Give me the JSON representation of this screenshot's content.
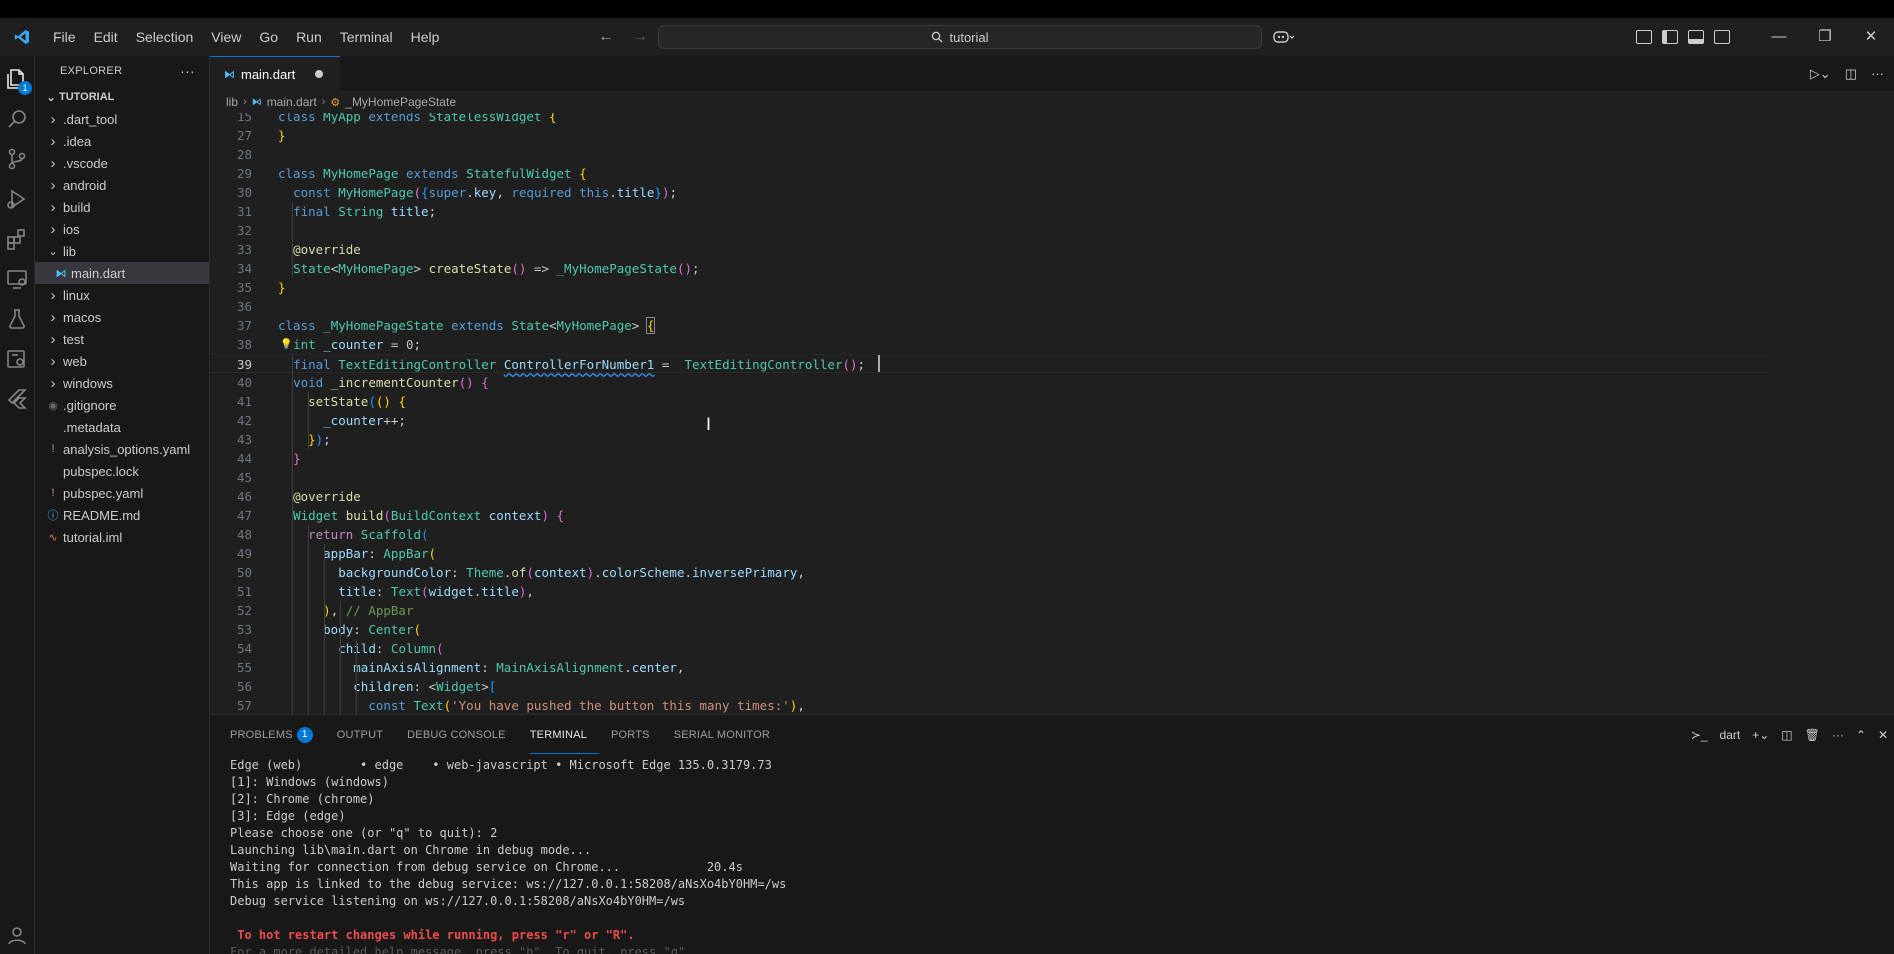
{
  "titlebar": {
    "menu": [
      "File",
      "Edit",
      "Selection",
      "View",
      "Go",
      "Run",
      "Terminal",
      "Help"
    ],
    "search_text": "tutorial",
    "back_label": "←",
    "forward_label": "→"
  },
  "explorer": {
    "header": "EXPLORER",
    "more_label": "···",
    "section": "TUTORIAL",
    "items": [
      {
        "label": ".dart_tool",
        "type": "folder",
        "open": false
      },
      {
        "label": ".idea",
        "type": "folder",
        "open": false
      },
      {
        "label": ".vscode",
        "type": "folder",
        "open": false
      },
      {
        "label": "android",
        "type": "folder",
        "open": false
      },
      {
        "label": "build",
        "type": "folder",
        "open": false
      },
      {
        "label": "ios",
        "type": "folder",
        "open": false
      },
      {
        "label": "lib",
        "type": "folder",
        "open": true
      },
      {
        "label": "main.dart",
        "type": "dart",
        "child": true,
        "selected": true
      },
      {
        "label": "linux",
        "type": "folder",
        "open": false
      },
      {
        "label": "macos",
        "type": "folder",
        "open": false
      },
      {
        "label": "test",
        "type": "folder",
        "open": false
      },
      {
        "label": "web",
        "type": "folder",
        "open": false
      },
      {
        "label": "windows",
        "type": "folder",
        "open": false
      },
      {
        "label": ".gitignore",
        "type": "gitignore"
      },
      {
        "label": ".metadata",
        "type": "file"
      },
      {
        "label": "analysis_options.yaml",
        "type": "yaml"
      },
      {
        "label": "pubspec.lock",
        "type": "file"
      },
      {
        "label": "pubspec.yaml",
        "type": "yaml"
      },
      {
        "label": "README.md",
        "type": "info"
      },
      {
        "label": "tutorial.iml",
        "type": "rss"
      }
    ]
  },
  "editor": {
    "tab_label": "main.dart",
    "breadcrumb": [
      "lib",
      "main.dart",
      "_MyHomePageState"
    ],
    "lines": [
      {
        "n": "15",
        "html": "<span class=\"kw\">class</span> <span class=\"ty\">MyApp</span> <span class=\"kw\">extends</span> <span class=\"ty\">StatelessWidget</span> <span class=\"br1\">{</span>"
      },
      {
        "n": "27",
        "html": "<span class=\"br1\">}</span>"
      },
      {
        "n": "28",
        "html": ""
      },
      {
        "n": "29",
        "html": "<span class=\"kw\">class</span> <span class=\"ty\">MyHomePage</span> <span class=\"kw\">extends</span> <span class=\"ty\">StatefulWidget</span> <span class=\"br1\">{</span>"
      },
      {
        "n": "30",
        "html": "  <span class=\"kw\">const</span> <span class=\"ty\">MyHomePage</span><span class=\"br2\">(</span><span class=\"br3\">{</span><span class=\"kw\">super</span>.<span class=\"vr\">key</span>, <span class=\"kw\">required</span> <span class=\"kw\">this</span>.<span class=\"vr\">title</span><span class=\"br3\">}</span><span class=\"br2\">)</span>;"
      },
      {
        "n": "31",
        "html": "  <span class=\"kw\">final</span> <span class=\"ty\">String</span> <span class=\"vr\">title</span>;"
      },
      {
        "n": "32",
        "html": ""
      },
      {
        "n": "33",
        "html": "  <span class=\"dc\">@override</span>"
      },
      {
        "n": "34",
        "html": "  <span class=\"ty\">State</span>&lt;<span class=\"ty\">MyHomePage</span>&gt; <span class=\"fn\">createState</span><span class=\"br2\">()</span> =&gt; <span class=\"ty\">_MyHomePageState</span><span class=\"br2\">()</span>;"
      },
      {
        "n": "35",
        "html": "<span class=\"br1\">}</span>"
      },
      {
        "n": "36",
        "html": ""
      },
      {
        "n": "37",
        "html": "<span class=\"kw\">class</span> <span class=\"ty\">_MyHomePageState</span> <span class=\"kw\">extends</span> <span class=\"ty\">State</span>&lt;<span class=\"ty\">MyHomePage</span>&gt; <span class=\"br1\" style=\"outline:1px solid #888\">{</span>"
      },
      {
        "n": "38",
        "html": "  <span class=\"ty\">int</span> <span class=\"vr\">_counter</span> = <span class=\"nu\">0</span>;",
        "bulb": true
      },
      {
        "n": "39",
        "html": "  <span class=\"kw\">final</span> <span class=\"ty\">TextEditingController</span> <span class=\"vr ul\">ControllerForNumber1</span> =  <span class=\"ty\">TextEditingController</span><span class=\"br2\">()</span>;",
        "current": true
      },
      {
        "n": "40",
        "html": "  <span class=\"kw\">void</span> <span class=\"fn\">_incrementCounter</span><span class=\"br2\">()</span> <span class=\"br2\">{</span>"
      },
      {
        "n": "41",
        "html": "    <span class=\"fn\">setState</span><span class=\"br3\">(</span><span class=\"br1\">()</span> <span class=\"br1\">{</span>"
      },
      {
        "n": "42",
        "html": "      <span class=\"vr\">_counter</span>++;"
      },
      {
        "n": "43",
        "html": "    <span class=\"br1\">}</span><span class=\"br3\">)</span>;"
      },
      {
        "n": "44",
        "html": "  <span class=\"br2\">}</span>"
      },
      {
        "n": "45",
        "html": ""
      },
      {
        "n": "46",
        "html": "  <span class=\"dc\">@override</span>"
      },
      {
        "n": "47",
        "html": "  <span class=\"ty\">Widget</span> <span class=\"fn\">build</span><span class=\"br2\">(</span><span class=\"ty\">BuildContext</span> <span class=\"vr\">context</span><span class=\"br2\">)</span> <span class=\"br2\">{</span>"
      },
      {
        "n": "48",
        "html": "    <span class=\"kw2\">return</span> <span class=\"ty\">Scaffold</span><span class=\"br3\">(</span>"
      },
      {
        "n": "49",
        "html": "      <span class=\"vr\">appBar</span>: <span class=\"ty\">AppBar</span><span class=\"br1\">(</span>"
      },
      {
        "n": "50",
        "html": "        <span class=\"vr\">backgroundColor</span>: <span class=\"ty\">Theme</span>.<span class=\"fn\">of</span><span class=\"br2\">(</span><span class=\"vr\">context</span><span class=\"br2\">)</span>.<span class=\"vr\">colorScheme</span>.<span class=\"vr\">inversePrimary</span>,"
      },
      {
        "n": "51",
        "html": "        <span class=\"vr\">title</span>: <span class=\"ty\">Text</span><span class=\"br2\">(</span><span class=\"vr\">widget</span>.<span class=\"vr\">title</span><span class=\"br2\">)</span>,"
      },
      {
        "n": "52",
        "html": "      <span class=\"br1\">)</span>, <span class=\"cm\">// AppBar</span>"
      },
      {
        "n": "53",
        "html": "      <span class=\"vr\">body</span>: <span class=\"ty\">Center</span><span class=\"br1\">(</span>"
      },
      {
        "n": "54",
        "html": "        <span class=\"vr\">child</span>: <span class=\"ty\">Column</span><span class=\"br2\">(</span>"
      },
      {
        "n": "55",
        "html": "          <span class=\"vr\">mainAxisAlignment</span>: <span class=\"ty\">MainAxisAlignment</span>.<span class=\"vr\">center</span>,"
      },
      {
        "n": "56",
        "html": "          <span class=\"vr\">children</span>: &lt;<span class=\"ty\">Widget</span>&gt;<span class=\"br3\">[</span>"
      },
      {
        "n": "57",
        "html": "            <span class=\"kw\">const</span> <span class=\"ty\">Text</span><span class=\"br1\">(</span><span class=\"st\">'You have pushed the button this many times:'</span><span class=\"br1\">)</span>,"
      }
    ]
  },
  "panel": {
    "tabs": [
      {
        "label": "PROBLEMS",
        "badge": "1"
      },
      {
        "label": "OUTPUT"
      },
      {
        "label": "DEBUG CONSOLE"
      },
      {
        "label": "TERMINAL",
        "active": true
      },
      {
        "label": "PORTS"
      },
      {
        "label": "SERIAL MONITOR"
      }
    ],
    "terminal_name": "dart",
    "terminal_lines": [
      "Edge (web)        • edge    • web-javascript • Microsoft Edge 135.0.3179.73",
      "[1]: Windows (windows)",
      "[2]: Chrome (chrome)",
      "[3]: Edge (edge)",
      "Please choose one (or \"q\" to quit): 2",
      "Launching lib\\main.dart on Chrome in debug mode...",
      "Waiting for connection from debug service on Chrome...            20.4s",
      "This app is linked to the debug service: ws://127.0.0.1:58208/aNsXo4bY0HM=/ws",
      "Debug service listening on ws://127.0.0.1:58208/aNsXo4bY0HM=/ws"
    ],
    "hot_restart_line": " To hot restart changes while running, press \"r\" or \"R\".",
    "faded_line": "For a more detailed help message, press \"h\". To quit, press \"q\"."
  }
}
